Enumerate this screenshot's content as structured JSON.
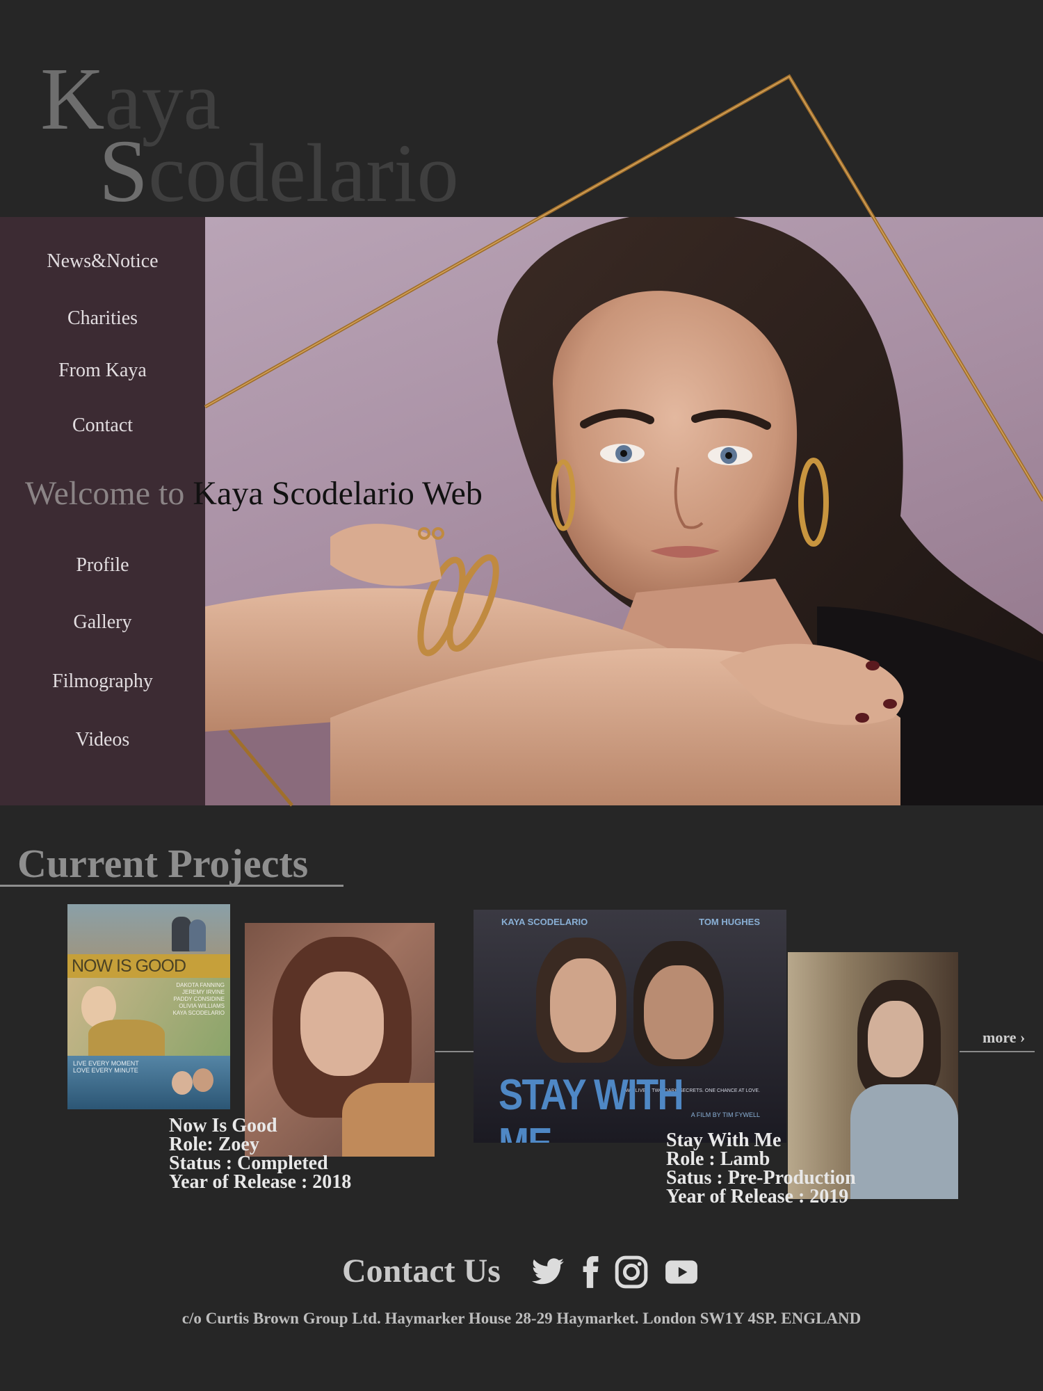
{
  "logo": {
    "line1_cap": "K",
    "line1_rest": "aya",
    "line2_cap": "S",
    "line2_rest": "codelario"
  },
  "nav": {
    "items": [
      {
        "label": "News&Notice"
      },
      {
        "label": "Charities"
      },
      {
        "label": "From Kaya"
      },
      {
        "label": "Contact"
      },
      {
        "label": "Profile"
      },
      {
        "label": "Gallery"
      },
      {
        "label": "Filmography"
      },
      {
        "label": "Videos"
      }
    ]
  },
  "welcome": {
    "prefix": "Welcome to",
    "name": "Kaya Scodelario Web"
  },
  "projects": {
    "title": "Current Projects",
    "more_label": "more",
    "items": [
      {
        "poster_title": "NOW IS GOOD",
        "poster_cast": [
          "DAKOTA FANNING",
          "JEREMY IRVINE",
          "PADDY CONSIDINE",
          "OLIVIA WILLIAMS",
          "KAYA SCODELARIO"
        ],
        "poster_tagline": [
          "LIVE EVERY MOMENT",
          "LOVE EVERY MINUTE"
        ],
        "title": "Now Is Good",
        "role": "Role: Zoey",
        "status": "Status : Completed",
        "year": "Year of Release : 2018"
      },
      {
        "poster_left_name": "KAYA SCODELARIO",
        "poster_right_name": "TOM HUGHES",
        "poster_tagline": "TWO LIVES. TWO DARK SECRETS. ONE CHANCE AT LOVE.",
        "poster_title": "STAY WITH ME",
        "poster_credit": "A FILM BY TIM FYWELL",
        "title": "Stay With Me",
        "role": "Role : Lamb",
        "status": "Satus : Pre-Production",
        "year": "Year of Release : 2019"
      }
    ]
  },
  "contact": {
    "title": "Contact Us",
    "address": "c/o Curtis Brown Group Ltd. Haymarker House 28-29 Haymarket. London SW1Y 4SP. ENGLAND",
    "social_icons": [
      "twitter-icon",
      "facebook-icon",
      "instagram-icon",
      "youtube-icon"
    ]
  },
  "colors": {
    "page_bg": "#262626",
    "sidebar_bg": "#3c2b33",
    "frame_gold": "#a06f2c",
    "hero_bg": "#b9a4b6"
  }
}
